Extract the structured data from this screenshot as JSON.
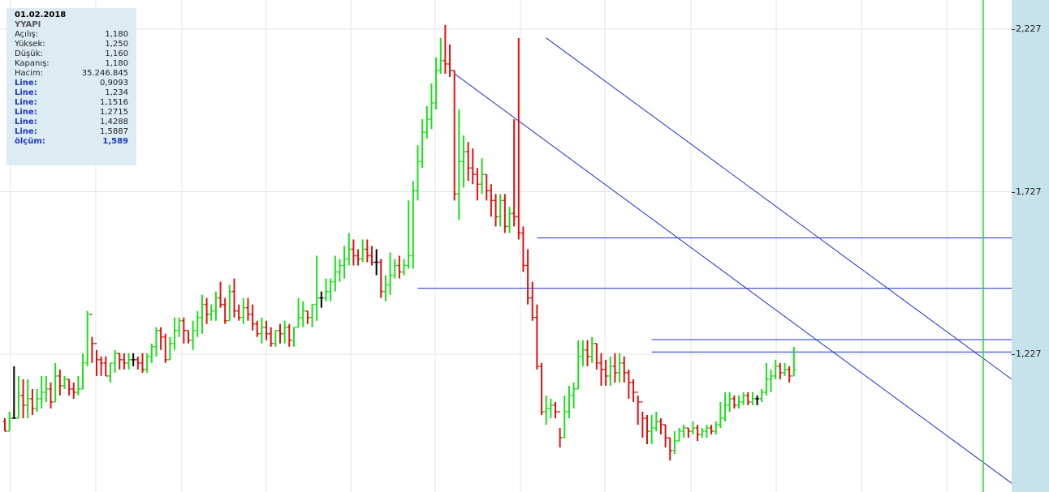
{
  "info": {
    "date": "01.02.2018",
    "symbol": "YYAPI",
    "rows": [
      {
        "label": "Açılış:",
        "value": "1,180",
        "kind": "normal"
      },
      {
        "label": "Yüksek:",
        "value": "1,250",
        "kind": "normal"
      },
      {
        "label": "Düşük:",
        "value": "1,160",
        "kind": "normal"
      },
      {
        "label": "Kapanış:",
        "value": "1,180",
        "kind": "normal"
      },
      {
        "label": "Hacim:",
        "value": "35.246.845",
        "kind": "normal"
      },
      {
        "label": "Line:",
        "value": "0,9093",
        "kind": "line"
      },
      {
        "label": "Line:",
        "value": "1,234",
        "kind": "line"
      },
      {
        "label": "Line:",
        "value": "1,1516",
        "kind": "line"
      },
      {
        "label": "Line:",
        "value": "1,2715",
        "kind": "line"
      },
      {
        "label": "Line:",
        "value": "1,4288",
        "kind": "line"
      },
      {
        "label": "Line:",
        "value": "1,5887",
        "kind": "line"
      },
      {
        "label": "ölçüm:",
        "value": "1,589",
        "kind": "olcum"
      }
    ]
  },
  "axis": {
    "ticks": [
      "2,227",
      "1,727",
      "1,227"
    ]
  },
  "chart_data": {
    "type": "ohlc",
    "ylim": [
      0.8,
      2.3
    ],
    "yticks": [
      2.227,
      1.727,
      1.227
    ],
    "grid": true,
    "colors": {
      "up": "#19e019",
      "down": "#e01010",
      "flat": "#000000",
      "lines": "#1c2fd0",
      "marker": "#22dd22"
    },
    "candles": [
      [
        1.02,
        0.99,
        1.03,
        0.99
      ],
      [
        0.99,
        1.03,
        1.05,
        0.99
      ],
      [
        1.03,
        1.03,
        1.19,
        1.03
      ],
      [
        1.03,
        1.1,
        1.16,
        1.03
      ],
      [
        1.1,
        1.07,
        1.15,
        1.03
      ],
      [
        1.07,
        1.09,
        1.15,
        1.03
      ],
      [
        1.09,
        1.06,
        1.12,
        1.04
      ],
      [
        1.06,
        1.09,
        1.12,
        1.05
      ],
      [
        1.09,
        1.11,
        1.16,
        1.06
      ],
      [
        1.11,
        1.12,
        1.16,
        1.08
      ],
      [
        1.12,
        1.08,
        1.14,
        1.06
      ],
      [
        1.08,
        1.16,
        1.2,
        1.08
      ],
      [
        1.16,
        1.13,
        1.18,
        1.1
      ],
      [
        1.13,
        1.15,
        1.16,
        1.12
      ],
      [
        1.15,
        1.12,
        1.15,
        1.1
      ],
      [
        1.12,
        1.11,
        1.14,
        1.09
      ],
      [
        1.11,
        1.12,
        1.16,
        1.1
      ],
      [
        1.12,
        1.2,
        1.23,
        1.12
      ],
      [
        1.2,
        1.35,
        1.36,
        1.19
      ],
      [
        1.35,
        1.26,
        1.28,
        1.2
      ],
      [
        1.26,
        1.21,
        1.24,
        1.16
      ],
      [
        1.21,
        1.2,
        1.22,
        1.16
      ],
      [
        1.2,
        1.16,
        1.22,
        1.16
      ],
      [
        1.16,
        1.2,
        1.2,
        1.14
      ],
      [
        1.2,
        1.23,
        1.24,
        1.17
      ],
      [
        1.23,
        1.21,
        1.23,
        1.18
      ],
      [
        1.21,
        1.2,
        1.23,
        1.18
      ],
      [
        1.2,
        1.21,
        1.23,
        1.18
      ],
      [
        1.21,
        1.21,
        1.23,
        1.19
      ],
      [
        1.21,
        1.2,
        1.22,
        1.18
      ],
      [
        1.2,
        1.18,
        1.23,
        1.17
      ],
      [
        1.18,
        1.22,
        1.23,
        1.17
      ],
      [
        1.22,
        1.25,
        1.26,
        1.2
      ],
      [
        1.25,
        1.3,
        1.31,
        1.22
      ],
      [
        1.3,
        1.28,
        1.31,
        1.24
      ],
      [
        1.28,
        1.21,
        1.29,
        1.2
      ],
      [
        1.21,
        1.26,
        1.28,
        1.21
      ],
      [
        1.26,
        1.3,
        1.34,
        1.24
      ],
      [
        1.3,
        1.33,
        1.34,
        1.28
      ],
      [
        1.33,
        1.3,
        1.34,
        1.26
      ],
      [
        1.3,
        1.27,
        1.3,
        1.26
      ],
      [
        1.27,
        1.3,
        1.33,
        1.24
      ],
      [
        1.3,
        1.34,
        1.36,
        1.28
      ],
      [
        1.34,
        1.38,
        1.41,
        1.29
      ],
      [
        1.38,
        1.35,
        1.4,
        1.32
      ],
      [
        1.35,
        1.36,
        1.38,
        1.33
      ],
      [
        1.36,
        1.4,
        1.42,
        1.33
      ],
      [
        1.4,
        1.38,
        1.45,
        1.37
      ],
      [
        1.38,
        1.33,
        1.4,
        1.32
      ],
      [
        1.33,
        1.42,
        1.44,
        1.33
      ],
      [
        1.42,
        1.36,
        1.46,
        1.34
      ],
      [
        1.36,
        1.34,
        1.38,
        1.33
      ],
      [
        1.34,
        1.37,
        1.4,
        1.32
      ],
      [
        1.37,
        1.35,
        1.4,
        1.33
      ],
      [
        1.35,
        1.32,
        1.38,
        1.3
      ],
      [
        1.32,
        1.29,
        1.33,
        1.28
      ],
      [
        1.29,
        1.31,
        1.34,
        1.26
      ],
      [
        1.31,
        1.29,
        1.33,
        1.27
      ],
      [
        1.29,
        1.26,
        1.31,
        1.25
      ],
      [
        1.26,
        1.3,
        1.3,
        1.25
      ],
      [
        1.3,
        1.29,
        1.32,
        1.26
      ],
      [
        1.29,
        1.31,
        1.33,
        1.26
      ],
      [
        1.31,
        1.27,
        1.32,
        1.25
      ],
      [
        1.27,
        1.31,
        1.31,
        1.25
      ],
      [
        1.31,
        1.34,
        1.4,
        1.31
      ],
      [
        1.34,
        1.36,
        1.39,
        1.31
      ],
      [
        1.36,
        1.34,
        1.36,
        1.32
      ],
      [
        1.34,
        1.38,
        1.38,
        1.31
      ],
      [
        1.38,
        1.4,
        1.53,
        1.33
      ],
      [
        1.4,
        1.4,
        1.42,
        1.37
      ],
      [
        1.4,
        1.42,
        1.46,
        1.39
      ],
      [
        1.42,
        1.45,
        1.46,
        1.39
      ],
      [
        1.45,
        1.48,
        1.53,
        1.42
      ],
      [
        1.48,
        1.5,
        1.52,
        1.45
      ],
      [
        1.5,
        1.52,
        1.56,
        1.46
      ],
      [
        1.52,
        1.55,
        1.6,
        1.5
      ],
      [
        1.55,
        1.53,
        1.58,
        1.5
      ],
      [
        1.53,
        1.52,
        1.55,
        1.5
      ],
      [
        1.52,
        1.55,
        1.58,
        1.51
      ],
      [
        1.55,
        1.53,
        1.58,
        1.51
      ],
      [
        1.53,
        1.51,
        1.56,
        1.5
      ],
      [
        1.51,
        1.51,
        1.55,
        1.47
      ],
      [
        1.51,
        1.42,
        1.52,
        1.4
      ],
      [
        1.42,
        1.44,
        1.47,
        1.39
      ],
      [
        1.44,
        1.47,
        1.54,
        1.41
      ],
      [
        1.47,
        1.5,
        1.52,
        1.46
      ],
      [
        1.5,
        1.48,
        1.53,
        1.46
      ],
      [
        1.48,
        1.5,
        1.52,
        1.47
      ],
      [
        1.5,
        1.53,
        1.7,
        1.49
      ],
      [
        1.53,
        1.73,
        1.76,
        1.49
      ],
      [
        1.73,
        1.82,
        1.87,
        1.7
      ],
      [
        1.82,
        1.91,
        1.95,
        1.8
      ],
      [
        1.91,
        1.95,
        1.99,
        1.89
      ],
      [
        1.95,
        2.0,
        2.06,
        1.92
      ],
      [
        2.0,
        2.1,
        2.14,
        1.98
      ],
      [
        2.1,
        2.13,
        2.2,
        2.09
      ],
      [
        2.13,
        2.12,
        2.24,
        2.09
      ],
      [
        2.12,
        2.1,
        2.18,
        2.08
      ],
      [
        2.1,
        1.72,
        2.1,
        1.7
      ],
      [
        1.72,
        1.82,
        1.98,
        1.64
      ],
      [
        1.82,
        1.85,
        1.9,
        1.74
      ],
      [
        1.85,
        1.8,
        1.88,
        1.76
      ],
      [
        1.8,
        1.78,
        1.86,
        1.75
      ],
      [
        1.78,
        1.75,
        1.8,
        1.7
      ],
      [
        1.75,
        1.78,
        1.83,
        1.72
      ],
      [
        1.78,
        1.73,
        1.78,
        1.7
      ],
      [
        1.73,
        1.7,
        1.75,
        1.65
      ],
      [
        1.7,
        1.65,
        1.72,
        1.62
      ],
      [
        1.65,
        1.7,
        1.72,
        1.62
      ],
      [
        1.7,
        1.62,
        1.72,
        1.6
      ],
      [
        1.62,
        1.66,
        1.68,
        1.6
      ],
      [
        1.66,
        1.65,
        1.95,
        1.62
      ],
      [
        1.65,
        1.6,
        2.2,
        1.58
      ],
      [
        1.6,
        1.5,
        1.62,
        1.48
      ],
      [
        1.5,
        1.4,
        1.55,
        1.38
      ],
      [
        1.4,
        1.34,
        1.45,
        1.33
      ],
      [
        1.34,
        1.19,
        1.38,
        1.18
      ],
      [
        1.19,
        1.05,
        1.2,
        1.04
      ],
      [
        1.05,
        1.06,
        1.1,
        1.01
      ],
      [
        1.06,
        1.07,
        1.09,
        1.03
      ],
      [
        1.07,
        1.05,
        1.08,
        1.03
      ],
      [
        1.05,
        0.97,
        1.0,
        0.94
      ],
      [
        0.97,
        1.05,
        1.1,
        0.97
      ],
      [
        1.05,
        1.1,
        1.13,
        1.03
      ],
      [
        1.1,
        1.12,
        1.14,
        1.06
      ],
      [
        1.12,
        1.22,
        1.27,
        1.12
      ],
      [
        1.22,
        1.24,
        1.27,
        1.19
      ],
      [
        1.24,
        1.22,
        1.27,
        1.19
      ],
      [
        1.22,
        1.26,
        1.28,
        1.2
      ],
      [
        1.26,
        1.2,
        1.26,
        1.18
      ],
      [
        1.2,
        1.18,
        1.23,
        1.13
      ],
      [
        1.18,
        1.16,
        1.21,
        1.13
      ],
      [
        1.16,
        1.19,
        1.22,
        1.13
      ],
      [
        1.19,
        1.17,
        1.23,
        1.14
      ],
      [
        1.17,
        1.2,
        1.23,
        1.14
      ],
      [
        1.2,
        1.17,
        1.22,
        1.14
      ],
      [
        1.17,
        1.14,
        1.18,
        1.09
      ],
      [
        1.14,
        1.11,
        1.15,
        1.08
      ],
      [
        1.11,
        1.08,
        1.1,
        1.01
      ],
      [
        1.08,
        1.03,
        1.05,
        0.97
      ],
      [
        1.03,
        0.99,
        1.04,
        0.95
      ],
      [
        0.99,
        1.0,
        1.04,
        0.95
      ],
      [
        1.0,
        1.02,
        1.05,
        0.99
      ],
      [
        1.02,
        1.01,
        1.03,
        0.98
      ],
      [
        1.01,
        0.97,
        1.01,
        0.94
      ],
      [
        0.97,
        0.93,
        0.97,
        0.9
      ],
      [
        0.93,
        0.96,
        0.99,
        0.92
      ],
      [
        0.96,
        0.99,
        1.0,
        0.96
      ],
      [
        0.99,
        1.0,
        1.01,
        0.97
      ],
      [
        1.0,
        0.99,
        1.0,
        0.97
      ],
      [
        0.99,
        1.0,
        1.02,
        0.98
      ],
      [
        1.0,
        0.98,
        1.01,
        0.96
      ],
      [
        0.98,
        0.99,
        1.0,
        0.97
      ],
      [
        0.99,
        1.0,
        1.01,
        0.97
      ],
      [
        1.0,
        0.99,
        1.01,
        0.98
      ],
      [
        0.99,
        1.01,
        1.02,
        0.98
      ],
      [
        1.01,
        1.03,
        1.08,
        1.0
      ],
      [
        1.03,
        1.07,
        1.11,
        1.02
      ],
      [
        1.07,
        1.09,
        1.11,
        1.05
      ],
      [
        1.09,
        1.07,
        1.1,
        1.06
      ],
      [
        1.07,
        1.08,
        1.1,
        1.06
      ],
      [
        1.08,
        1.1,
        1.11,
        1.07
      ],
      [
        1.1,
        1.08,
        1.11,
        1.07
      ],
      [
        1.08,
        1.09,
        1.11,
        1.07
      ],
      [
        1.09,
        1.09,
        1.1,
        1.07
      ],
      [
        1.09,
        1.11,
        1.12,
        1.08
      ],
      [
        1.11,
        1.15,
        1.2,
        1.1
      ],
      [
        1.15,
        1.16,
        1.18,
        1.11
      ],
      [
        1.16,
        1.19,
        1.21,
        1.15
      ],
      [
        1.19,
        1.17,
        1.2,
        1.15
      ],
      [
        1.17,
        1.18,
        1.2,
        1.16
      ],
      [
        1.18,
        1.16,
        1.19,
        1.14
      ],
      [
        1.16,
        1.18,
        1.25,
        1.16
      ]
    ],
    "lines": [
      {
        "kind": "hline",
        "from": 116,
        "to": "end",
        "value": 1.585
      },
      {
        "kind": "hline",
        "from": 90,
        "to": "end",
        "value": 1.43
      },
      {
        "kind": "hline",
        "from": 141,
        "to": "end",
        "value": 1.272
      },
      {
        "kind": "hline",
        "from": 141,
        "to": "end",
        "value": 1.234
      },
      {
        "kind": "trend",
        "from": [
          98,
          2.09
        ],
        "to": [
          "end",
          0.83
        ]
      },
      {
        "kind": "trend",
        "from": [
          118,
          2.2
        ],
        "to": [
          "end",
          1.15
        ]
      }
    ],
    "marker_index": 207
  }
}
